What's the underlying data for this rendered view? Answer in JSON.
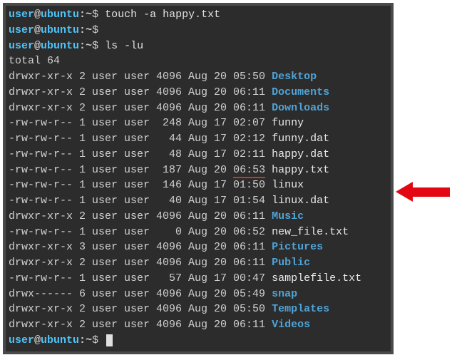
{
  "prompt": {
    "user": "user",
    "at": "@",
    "host": "ubuntu",
    "colon": ":",
    "path": "~",
    "dollar": "$"
  },
  "commands": {
    "c1": " touch -a happy.txt",
    "c2": "",
    "c3": " ls -lu",
    "c4": " "
  },
  "total": "total 64",
  "rows": [
    {
      "perm": "drwxr-xr-x",
      "links": "2",
      "owner": "user",
      "group": "user",
      "size": "4096",
      "mon": "Aug",
      "day": "20",
      "time": "05:50",
      "name": "Desktop",
      "isdir": true,
      "hl": false
    },
    {
      "perm": "drwxr-xr-x",
      "links": "2",
      "owner": "user",
      "group": "user",
      "size": "4096",
      "mon": "Aug",
      "day": "20",
      "time": "06:11",
      "name": "Documents",
      "isdir": true,
      "hl": false
    },
    {
      "perm": "drwxr-xr-x",
      "links": "2",
      "owner": "user",
      "group": "user",
      "size": "4096",
      "mon": "Aug",
      "day": "20",
      "time": "06:11",
      "name": "Downloads",
      "isdir": true,
      "hl": false
    },
    {
      "perm": "-rw-rw-r--",
      "links": "1",
      "owner": "user",
      "group": "user",
      "size": "248",
      "mon": "Aug",
      "day": "17",
      "time": "02:07",
      "name": "funny",
      "isdir": false,
      "hl": false
    },
    {
      "perm": "-rw-rw-r--",
      "links": "1",
      "owner": "user",
      "group": "user",
      "size": "44",
      "mon": "Aug",
      "day": "17",
      "time": "02:12",
      "name": "funny.dat",
      "isdir": false,
      "hl": false
    },
    {
      "perm": "-rw-rw-r--",
      "links": "1",
      "owner": "user",
      "group": "user",
      "size": "48",
      "mon": "Aug",
      "day": "17",
      "time": "02:11",
      "name": "happy.dat",
      "isdir": false,
      "hl": false
    },
    {
      "perm": "-rw-rw-r--",
      "links": "1",
      "owner": "user",
      "group": "user",
      "size": "187",
      "mon": "Aug",
      "day": "20",
      "time": "06:53",
      "name": "happy.txt",
      "isdir": false,
      "hl": true
    },
    {
      "perm": "-rw-rw-r--",
      "links": "1",
      "owner": "user",
      "group": "user",
      "size": "146",
      "mon": "Aug",
      "day": "17",
      "time": "01:50",
      "name": "linux",
      "isdir": false,
      "hl": false
    },
    {
      "perm": "-rw-rw-r--",
      "links": "1",
      "owner": "user",
      "group": "user",
      "size": "40",
      "mon": "Aug",
      "day": "17",
      "time": "01:54",
      "name": "linux.dat",
      "isdir": false,
      "hl": false
    },
    {
      "perm": "drwxr-xr-x",
      "links": "2",
      "owner": "user",
      "group": "user",
      "size": "4096",
      "mon": "Aug",
      "day": "20",
      "time": "06:11",
      "name": "Music",
      "isdir": true,
      "hl": false
    },
    {
      "perm": "-rw-rw-r--",
      "links": "1",
      "owner": "user",
      "group": "user",
      "size": "0",
      "mon": "Aug",
      "day": "20",
      "time": "06:52",
      "name": "new_file.txt",
      "isdir": false,
      "hl": false
    },
    {
      "perm": "drwxr-xr-x",
      "links": "3",
      "owner": "user",
      "group": "user",
      "size": "4096",
      "mon": "Aug",
      "day": "20",
      "time": "06:11",
      "name": "Pictures",
      "isdir": true,
      "hl": false
    },
    {
      "perm": "drwxr-xr-x",
      "links": "2",
      "owner": "user",
      "group": "user",
      "size": "4096",
      "mon": "Aug",
      "day": "20",
      "time": "06:11",
      "name": "Public",
      "isdir": true,
      "hl": false
    },
    {
      "perm": "-rw-rw-r--",
      "links": "1",
      "owner": "user",
      "group": "user",
      "size": "57",
      "mon": "Aug",
      "day": "17",
      "time": "00:47",
      "name": "samplefile.txt",
      "isdir": false,
      "hl": false
    },
    {
      "perm": "drwx------",
      "links": "6",
      "owner": "user",
      "group": "user",
      "size": "4096",
      "mon": "Aug",
      "day": "20",
      "time": "05:49",
      "name": "snap",
      "isdir": true,
      "hl": false
    },
    {
      "perm": "drwxr-xr-x",
      "links": "2",
      "owner": "user",
      "group": "user",
      "size": "4096",
      "mon": "Aug",
      "day": "20",
      "time": "05:50",
      "name": "Templates",
      "isdir": true,
      "hl": false
    },
    {
      "perm": "drwxr-xr-x",
      "links": "2",
      "owner": "user",
      "group": "user",
      "size": "4096",
      "mon": "Aug",
      "day": "20",
      "time": "06:11",
      "name": "Videos",
      "isdir": true,
      "hl": false
    }
  ]
}
